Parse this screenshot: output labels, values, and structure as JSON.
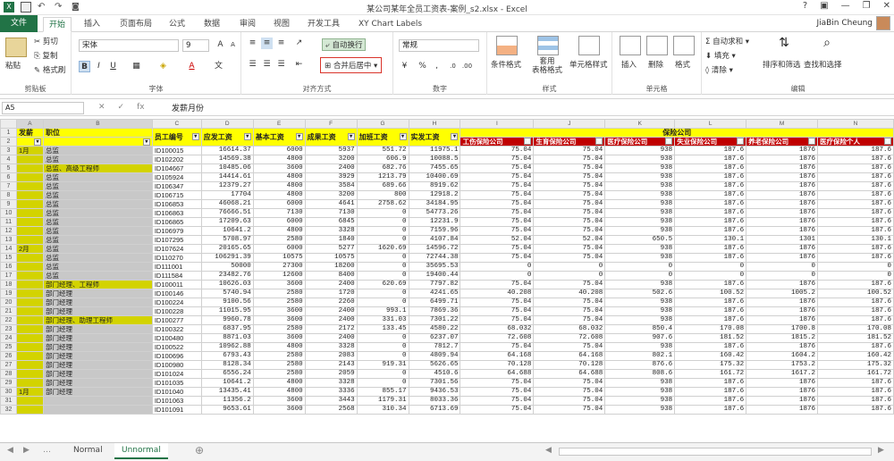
{
  "title": "某公司某年全员工资表-案例_s2.xlsx - Excel",
  "user": "JiaBin Cheung",
  "tabs": [
    "文件",
    "开始",
    "插入",
    "页面布局",
    "公式",
    "数据",
    "审阅",
    "视图",
    "开发工具",
    "XY Chart Labels"
  ],
  "ribbon": {
    "paste": "粘贴",
    "cut": "剪切",
    "copy": "复制",
    "format_painter": "格式刷",
    "clipboard": "剪贴板",
    "font_name": "宋体",
    "font_size": "9",
    "font_group": "字体",
    "wrap": "自动换行",
    "merge": "合并后居中",
    "align_group": "对齐方式",
    "number_format": "常规",
    "number_group": "数字",
    "cond": "条件格式",
    "table_fmt": "套用\n表格格式",
    "cell_style": "单元格样式",
    "style_group": "样式",
    "insert": "插入",
    "delete": "删除",
    "format": "格式",
    "cells_group": "单元格",
    "autosum": "自动求和",
    "fill": "填充",
    "clear": "清除",
    "sort": "排序和筛选",
    "find": "查找和选择",
    "edit_group": "编辑"
  },
  "name_box": "A5",
  "formula": "发薪月份",
  "columns": [
    "A",
    "B",
    "C",
    "D",
    "E",
    "F",
    "G",
    "H",
    "I",
    "J",
    "K",
    "L",
    "M",
    "N"
  ],
  "header_row1": {
    "A": "发薪",
    "B": "职位",
    "C": "员工编号",
    "D": "应发工资",
    "E": "基本工资",
    "F": "成果工资",
    "G": "加班工资",
    "H": "实发工资",
    "K": "保险公司"
  },
  "header_row2": [
    "工伤保险公司",
    "生育保险公司",
    "医疗保险公司",
    "失业保险公司",
    "养老保险公司",
    "医疗保险个人",
    "失"
  ],
  "rows": [
    [
      "3",
      "1月",
      "总监",
      "ID100015",
      "16614.37",
      "6000",
      "5937",
      "551.72",
      "11975.1",
      "75.04",
      "75.04",
      "938",
      "187.6",
      "1876",
      "187.6"
    ],
    [
      "4",
      "",
      "总监",
      "ID102202",
      "14569.38",
      "4800",
      "3200",
      "606.9",
      "10088.5",
      "75.04",
      "75.04",
      "938",
      "187.6",
      "1876",
      "187.6"
    ],
    [
      "5",
      "",
      "总监、高级工程师",
      "ID104667",
      "10485.06",
      "3600",
      "2400",
      "682.76",
      "7455.65",
      "75.04",
      "75.04",
      "938",
      "187.6",
      "1876",
      "187.6"
    ],
    [
      "6",
      "",
      "总监",
      "ID105924",
      "14414.61",
      "4800",
      "3929",
      "1213.79",
      "10400.69",
      "75.04",
      "75.04",
      "938",
      "187.6",
      "1876",
      "187.6"
    ],
    [
      "7",
      "",
      "总监",
      "ID106347",
      "12379.27",
      "4800",
      "3584",
      "689.66",
      "8919.62",
      "75.04",
      "75.04",
      "938",
      "187.6",
      "1876",
      "187.6"
    ],
    [
      "8",
      "",
      "总监",
      "ID106715",
      "17704",
      "4800",
      "3200",
      "800",
      "12918.2",
      "75.04",
      "75.04",
      "938",
      "187.6",
      "1876",
      "187.6"
    ],
    [
      "9",
      "",
      "总监",
      "ID106853",
      "46068.21",
      "6000",
      "4641",
      "2758.62",
      "34184.95",
      "75.04",
      "75.04",
      "938",
      "187.6",
      "1876",
      "187.6"
    ],
    [
      "10",
      "",
      "总监",
      "ID106863",
      "76666.51",
      "7130",
      "7130",
      "0",
      "54773.26",
      "75.04",
      "75.04",
      "938",
      "187.6",
      "1876",
      "187.6"
    ],
    [
      "11",
      "",
      "总监",
      "ID106865",
      "17209.63",
      "6000",
      "6845",
      "0",
      "12231.9",
      "75.04",
      "75.04",
      "938",
      "187.6",
      "1876",
      "187.6"
    ],
    [
      "12",
      "",
      "总监",
      "ID106979",
      "10641.2",
      "4800",
      "3328",
      "0",
      "7159.96",
      "75.04",
      "75.04",
      "938",
      "187.6",
      "1876",
      "187.6"
    ],
    [
      "13",
      "",
      "总监",
      "ID107295",
      "5708.97",
      "2580",
      "1840",
      "0",
      "4107.84",
      "52.04",
      "52.04",
      "650.5",
      "130.1",
      "1301",
      "130.1"
    ],
    [
      "14",
      "2月",
      "总监",
      "ID107624",
      "20165.65",
      "6000",
      "5277",
      "1620.69",
      "14596.72",
      "75.04",
      "75.04",
      "938",
      "187.6",
      "1876",
      "187.6"
    ],
    [
      "15",
      "",
      "总监",
      "ID110270",
      "106291.39",
      "10575",
      "10575",
      "0",
      "72744.38",
      "75.04",
      "75.04",
      "938",
      "187.6",
      "1876",
      "187.6"
    ],
    [
      "16",
      "",
      "总监",
      "ID111001",
      "50000",
      "27300",
      "18200",
      "0",
      "35695.53",
      "0",
      "0",
      "0",
      "0",
      "0",
      "0"
    ],
    [
      "17",
      "",
      "总监",
      "ID111584",
      "23482.76",
      "12600",
      "8400",
      "0",
      "19400.44",
      "0",
      "0",
      "0",
      "0",
      "0",
      "0"
    ],
    [
      "18",
      "",
      "部门经理、工程师",
      "ID100011",
      "10626.03",
      "3600",
      "2400",
      "620.69",
      "7797.82",
      "75.04",
      "75.04",
      "938",
      "187.6",
      "1876",
      "187.6"
    ],
    [
      "19",
      "",
      "部门经理",
      "ID100146",
      "5740.94",
      "2580",
      "1720",
      "0",
      "4241.65",
      "40.208",
      "40.208",
      "502.6",
      "100.52",
      "1005.2",
      "100.52"
    ],
    [
      "20",
      "",
      "部门经理",
      "ID100224",
      "9100.56",
      "2580",
      "2260",
      "0",
      "6499.71",
      "75.04",
      "75.04",
      "938",
      "187.6",
      "1876",
      "187.6"
    ],
    [
      "21",
      "",
      "部门经理",
      "ID100228",
      "11015.95",
      "3600",
      "2400",
      "993.1",
      "7869.36",
      "75.04",
      "75.04",
      "938",
      "187.6",
      "1876",
      "187.6"
    ],
    [
      "22",
      "",
      "部门经理、助理工程师",
      "ID100277",
      "9960.78",
      "3600",
      "2400",
      "331.03",
      "7301.22",
      "75.04",
      "75.04",
      "938",
      "187.6",
      "1876",
      "187.6"
    ],
    [
      "23",
      "",
      "部门经理",
      "ID100322",
      "6837.95",
      "2580",
      "2172",
      "133.45",
      "4580.22",
      "68.032",
      "68.032",
      "850.4",
      "170.08",
      "1700.8",
      "170.08"
    ],
    [
      "24",
      "",
      "部门经理",
      "ID100480",
      "8871.03",
      "3600",
      "2400",
      "0",
      "6237.07",
      "72.608",
      "72.608",
      "907.6",
      "181.52",
      "1815.2",
      "181.52"
    ],
    [
      "25",
      "",
      "部门经理",
      "ID100522",
      "10962.88",
      "4800",
      "3328",
      "0",
      "7812.7",
      "75.04",
      "75.04",
      "938",
      "187.6",
      "1876",
      "187.6"
    ],
    [
      "26",
      "",
      "部门经理",
      "ID100696",
      "6793.43",
      "2580",
      "2083",
      "0",
      "4809.94",
      "64.168",
      "64.168",
      "802.1",
      "160.42",
      "1604.2",
      "160.42"
    ],
    [
      "27",
      "",
      "部门经理",
      "ID100980",
      "8128.34",
      "2580",
      "2143",
      "919.31",
      "5626.65",
      "70.128",
      "70.128",
      "876.6",
      "175.32",
      "1753.2",
      "175.32"
    ],
    [
      "28",
      "",
      "部门经理",
      "ID101024",
      "6556.24",
      "2580",
      "2059",
      "0",
      "4510.6",
      "64.688",
      "64.688",
      "808.6",
      "161.72",
      "1617.2",
      "161.72"
    ],
    [
      "29",
      "",
      "部门经理",
      "ID101035",
      "10641.2",
      "4800",
      "3328",
      "0",
      "7301.56",
      "75.04",
      "75.04",
      "938",
      "187.6",
      "1876",
      "187.6"
    ],
    [
      "30",
      "1月",
      "部门经理",
      "ID101040",
      "13435.41",
      "4800",
      "3336",
      "855.17",
      "9436.53",
      "75.04",
      "75.04",
      "938",
      "187.6",
      "1876",
      "187.6"
    ],
    [
      "31",
      "",
      "",
      "ID101063",
      "11356.2",
      "3600",
      "3443",
      "1179.31",
      "8033.36",
      "75.04",
      "75.04",
      "938",
      "187.6",
      "1876",
      "187.6"
    ],
    [
      "32",
      "",
      "",
      "ID101091",
      "9653.61",
      "3600",
      "2568",
      "310.34",
      "6713.69",
      "75.04",
      "75.04",
      "938",
      "187.6",
      "1876",
      "187.6"
    ]
  ],
  "sheets": [
    "Normal",
    "Unnormal"
  ],
  "active_sheet": "Unnormal"
}
